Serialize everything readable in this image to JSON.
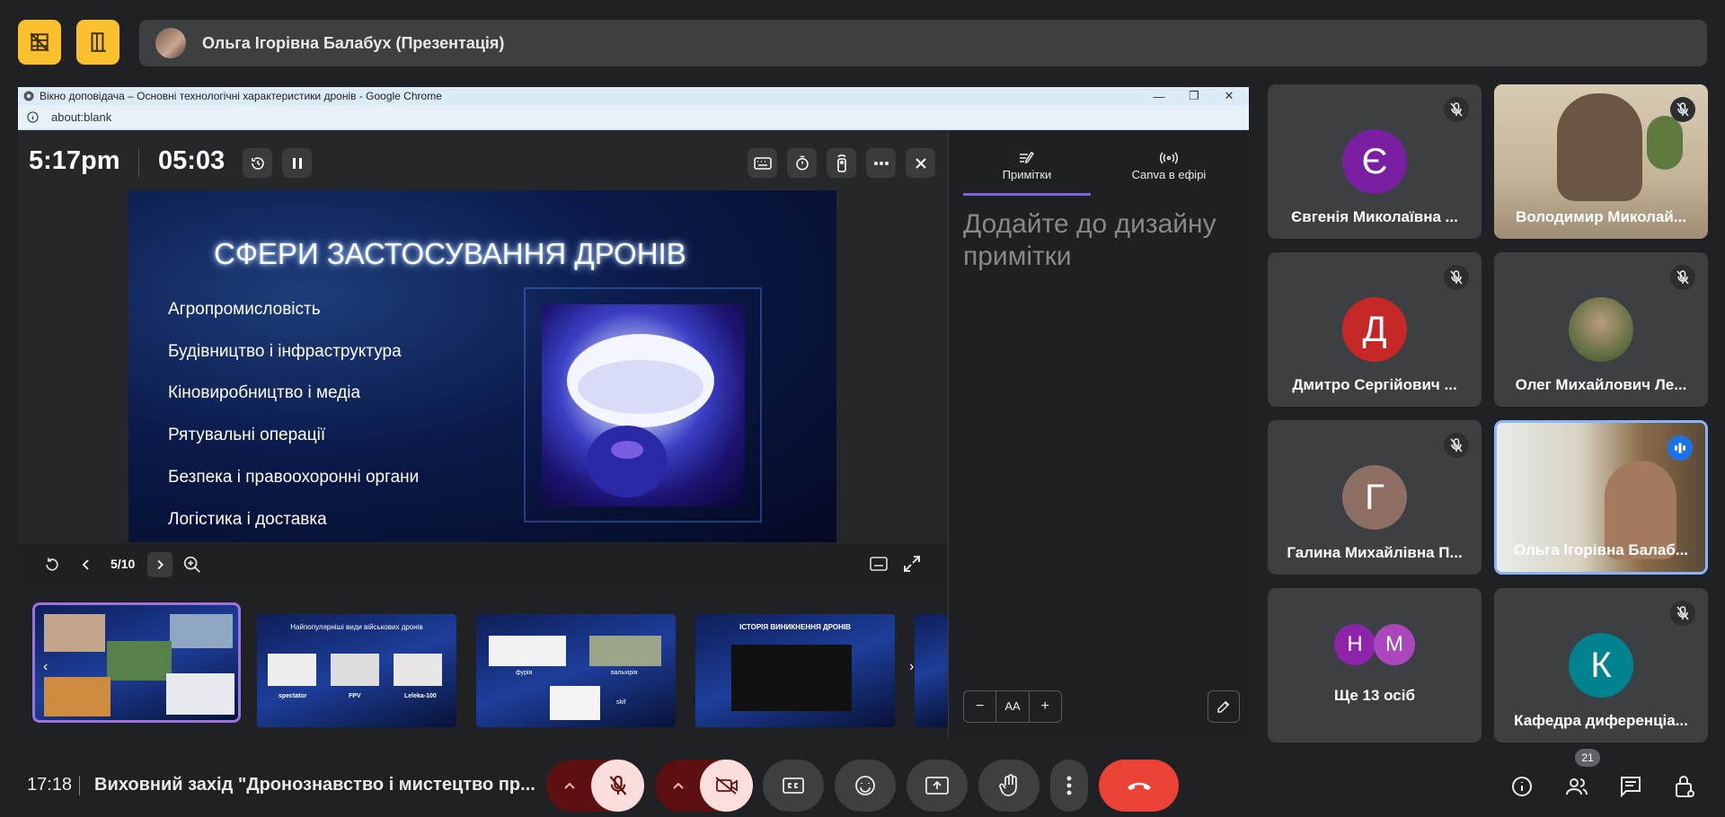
{
  "top_bar": {
    "presenter_name": "Ольга Ігорівна Балабух (Презентація)"
  },
  "browser": {
    "window_title": "Вікно доповідача – Основні технологічні характеристики дронів - Google Chrome",
    "address": "about:blank"
  },
  "presenter": {
    "clock": "5:17pm",
    "timer": "05:03",
    "page_indicator": "5/10",
    "slide": {
      "title": "СФЕРИ ЗАСТОСУВАННЯ ДРОНІВ",
      "items": [
        "Агропромисловість",
        "Будівництво і інфраструктура",
        "Кіновиробництво і медіа",
        "Рятувальні операції",
        "Безпека і правоохоронні органи",
        "Логістика і доставка"
      ]
    },
    "thumbnails": [
      {
        "title": "",
        "labels": []
      },
      {
        "title": "Найпопулярніші види військових дронів",
        "labels": [
          "spectator",
          "FPV",
          "Leleka-100"
        ]
      },
      {
        "title": "",
        "labels": [
          "фурія",
          "вальхірія",
          "skif"
        ]
      },
      {
        "title": "ІСТОРІЯ ВИНИКНЕННЯ ДРОНІВ",
        "labels": []
      }
    ],
    "notes": {
      "tab_notes": "Примітки",
      "tab_live": "Canva в ефірі",
      "placeholder": "Додайте до дизайну примітки",
      "text_size_label": "AA"
    }
  },
  "participants": [
    {
      "name": "Євгенія Миколаївна ...",
      "initial": "Є",
      "color": "#7b1fa2",
      "muted": true,
      "video": false
    },
    {
      "name": "Володимир Миколай...",
      "initial": "",
      "color": "",
      "muted": true,
      "video": true
    },
    {
      "name": "Дмитро Сергійович ...",
      "initial": "Д",
      "color": "#c62828",
      "muted": true,
      "video": false
    },
    {
      "name": "Олег Михайлович Ле...",
      "initial": "",
      "color": "",
      "muted": true,
      "video": false
    },
    {
      "name": "Галина Михайлівна П...",
      "initial": "Г",
      "color": "#8d6e63",
      "muted": true,
      "video": false
    },
    {
      "name": "Ольга Ігорівна Балаб...",
      "initial": "",
      "color": "",
      "muted": false,
      "video": true,
      "speaking": true
    },
    {
      "name": "Ще 13 осіб",
      "initials": [
        "Н",
        "М"
      ],
      "colors": [
        "#8e24aa",
        "#ab47bc"
      ]
    },
    {
      "name": "Кафедра диференціа...",
      "initial": "К",
      "color": "#00838f",
      "muted": true,
      "video": false
    }
  ],
  "bottom_bar": {
    "time": "17:18",
    "meeting_title": "Виховний захід \"Дронознавство і мистецтво пр...",
    "participant_count": "21"
  },
  "colors": {
    "accent_yellow": "#fbc02d",
    "end_call": "#ea4335",
    "muted_bg": "#f9dedc",
    "muted_dark": "#5c1010",
    "selected_thumb": "#9b72e0",
    "speaking_border": "#8ab4f8"
  }
}
